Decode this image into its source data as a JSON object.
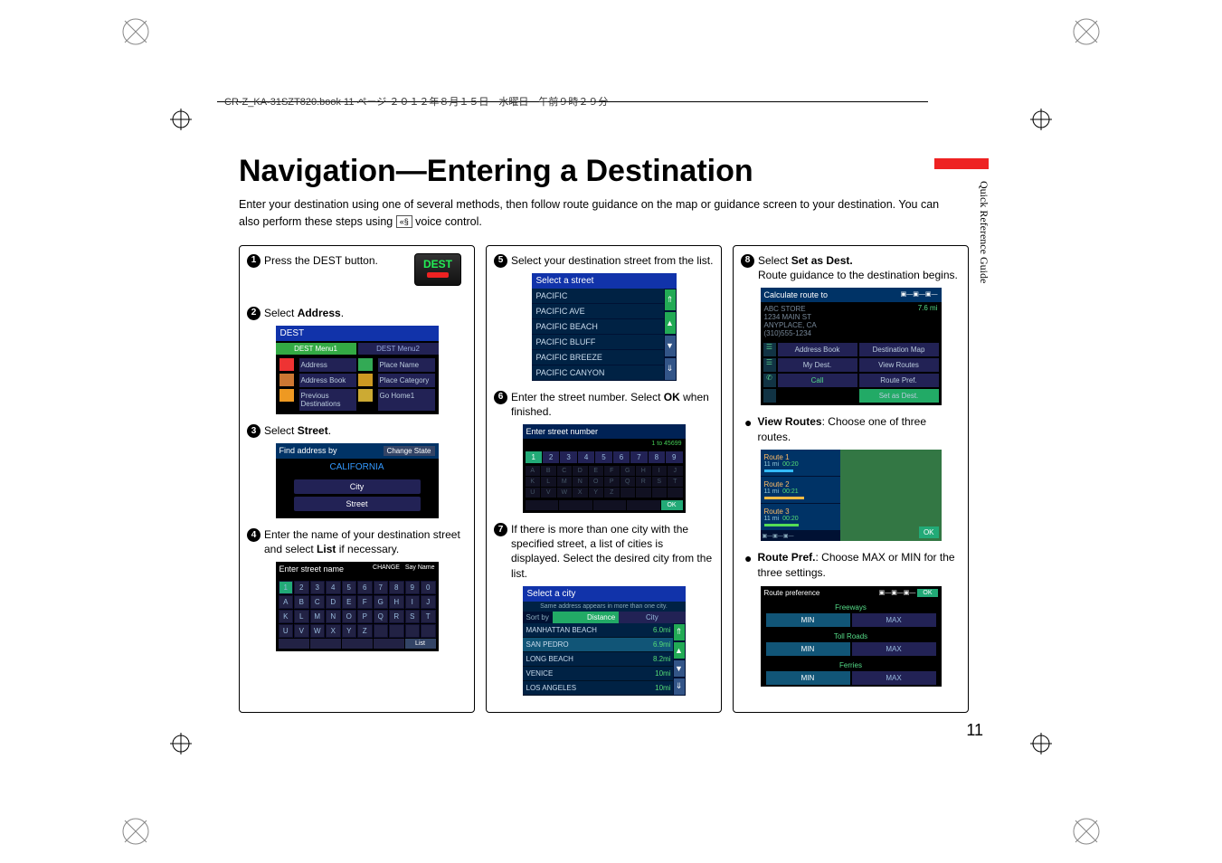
{
  "header": "CR-Z_KA-31SZT820.book  11 ページ  ２０１２年８月１５日　水曜日　午前９時２９分",
  "title": "Navigation—Entering a Destination",
  "intro": "Enter your destination using one of several methods, then follow route guidance on the map or guidance screen to your destination. You can also perform these steps using ",
  "intro2": " voice control.",
  "voice_glyph": "«§",
  "side_label": "Quick Reference Guide",
  "page_num": "11",
  "steps": {
    "s1": "Press the DEST button.",
    "dest_label": "DEST",
    "s2_a": "Select ",
    "s2_b": "Address",
    "s2_c": ".",
    "s3_a": "Select ",
    "s3_b": "Street",
    "s3_c": ".",
    "s4_a": "Enter the name of your destination street and select ",
    "s4_b": "List",
    "s4_c": " if necessary.",
    "s5": "Select your destination street from the list.",
    "s6_a": "Enter the street number. Select ",
    "s6_b": "OK",
    "s6_c": " when finished.",
    "s7": "If there is more than one city with the specified street, a list of cities is displayed. Select the desired city from the list.",
    "s8_a": "Select ",
    "s8_b": "Set as Dest.",
    "s8_c": "Route guidance to the destination begins."
  },
  "screen2": {
    "hdr": "DEST",
    "tab1": "DEST Menu1",
    "tab2": "DEST Menu2",
    "items": [
      "Address",
      "Place Name",
      "Address Book",
      "Place Category",
      "Previous Destinations",
      "Go Home1"
    ]
  },
  "screen3": {
    "hdr": "Find address by",
    "chg": "Change State",
    "state": "CALIFORNIA",
    "city": "City",
    "street": "Street"
  },
  "screen4": {
    "hdr": "Enter street name",
    "change": "CHANGE",
    "say": "Say Name",
    "list": "List"
  },
  "screen5": {
    "hdr": "Select a street",
    "items": [
      "PACIFIC",
      "PACIFIC AVE",
      "PACIFIC BEACH",
      "PACIFIC BLUFF",
      "PACIFIC BREEZE",
      "PACIFIC CANYON"
    ]
  },
  "screen6": {
    "hdr": "Enter street number",
    "range": "1 to 45699",
    "ok": "OK"
  },
  "screen7": {
    "hdr": "Select a city",
    "sub": "Same address appears in more than one city.",
    "sort": "Sort by",
    "dist": "Distance",
    "city": "City",
    "rows": [
      {
        "n": "MANHATTAN BEACH",
        "d": "6.0mi"
      },
      {
        "n": "SAN PEDRO",
        "d": "6.9mi"
      },
      {
        "n": "LONG BEACH",
        "d": "8.2mi"
      },
      {
        "n": "VENICE",
        "d": "10mi"
      },
      {
        "n": "LOS ANGELES",
        "d": "10mi"
      }
    ]
  },
  "screen8": {
    "hdr": "Calculate route to",
    "lines": [
      "ABC STORE",
      "1234 MAIN ST",
      "ANYPLACE, CA",
      "(310)555-1234"
    ],
    "dist": "7.6 mi",
    "btns": [
      "Address Book",
      "Destination Map",
      "My Dest.",
      "View Routes",
      "Call",
      "Route Pref.",
      "",
      "Set as Dest."
    ]
  },
  "bullets": {
    "b1_a": "View Routes",
    "b1_b": ": Choose one of three routes.",
    "b2_a": "Route Pref.",
    "b2_b": ": Choose MAX or MIN for the three settings."
  },
  "screen9": {
    "routes": [
      {
        "n": "Route 1",
        "mi": "11 mi",
        "tm": "00:20"
      },
      {
        "n": "Route 2",
        "mi": "11 mi",
        "tm": "00:21"
      },
      {
        "n": "Route 3",
        "mi": "11 mi",
        "tm": "00:20"
      }
    ],
    "ok": "OK"
  },
  "screen10": {
    "hdr": "Route preference",
    "ok": "OK",
    "sections": [
      "Freeways",
      "Toll Roads",
      "Ferries"
    ],
    "min": "MIN",
    "max": "MAX"
  }
}
